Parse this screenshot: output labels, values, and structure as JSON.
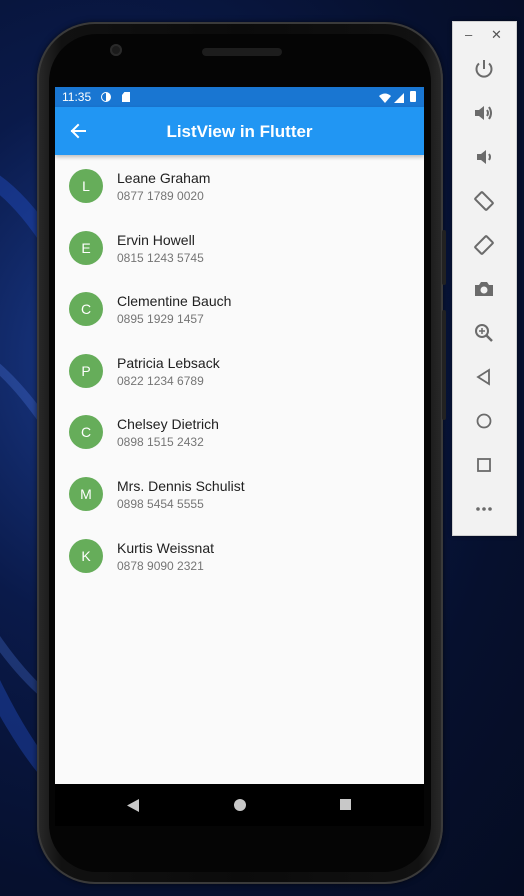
{
  "status_bar": {
    "time": "11:35"
  },
  "app_bar": {
    "title": "ListView in Flutter"
  },
  "contacts": [
    {
      "initial": "L",
      "name": "Leane Graham",
      "phone": "0877 1789 0020"
    },
    {
      "initial": "E",
      "name": "Ervin Howell",
      "phone": "0815 1243 5745"
    },
    {
      "initial": "C",
      "name": "Clementine Bauch",
      "phone": "0895 1929 1457"
    },
    {
      "initial": "P",
      "name": "Patricia Lebsack",
      "phone": "0822 1234 6789"
    },
    {
      "initial": "C",
      "name": "Chelsey Dietrich",
      "phone": "0898 1515 2432"
    },
    {
      "initial": "M",
      "name": "Mrs. Dennis Schulist",
      "phone": "0898 5454 5555"
    },
    {
      "initial": "K",
      "name": "Kurtis Weissnat",
      "phone": "0878 9090 2321"
    }
  ],
  "colors": {
    "app_bar": "#2196f3",
    "status_bar": "#1976d2",
    "avatar": "#66ad5a"
  },
  "toolbar": {
    "window_controls": [
      "minimize-icon",
      "close-icon"
    ],
    "buttons": [
      "power-icon",
      "volume-up-icon",
      "volume-down-icon",
      "rotate-left-icon",
      "rotate-right-icon",
      "camera-icon",
      "zoom-icon",
      "back-icon",
      "home-icon",
      "overview-icon",
      "more-icon"
    ]
  }
}
